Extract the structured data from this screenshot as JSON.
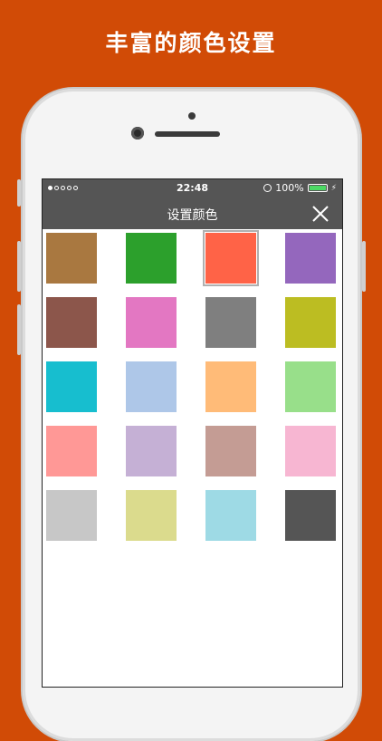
{
  "promo": {
    "title": "丰富的颜色设置"
  },
  "status_bar": {
    "time": "22:48",
    "battery": "100%",
    "signal_dots": [
      true,
      false,
      false,
      false,
      false
    ]
  },
  "nav": {
    "title": "设置颜色",
    "close_icon": "close-icon"
  },
  "colors": {
    "background": "#D14B06",
    "bar": "#555555"
  },
  "palette": {
    "selected_index": 2,
    "swatches": [
      "#A97840",
      "#2CA02C",
      "#FF6347",
      "#9467BD",
      "#8C564B",
      "#E377C2",
      "#7F7F7F",
      "#BCBD22",
      "#17BECF",
      "#AEC7E8",
      "#FFBB78",
      "#98DF8A",
      "#FF9896",
      "#C5B0D5",
      "#C49C94",
      "#F7B6D2",
      "#C7C7C7",
      "#DBDB8D",
      "#9EDAE5",
      "#555555"
    ]
  }
}
